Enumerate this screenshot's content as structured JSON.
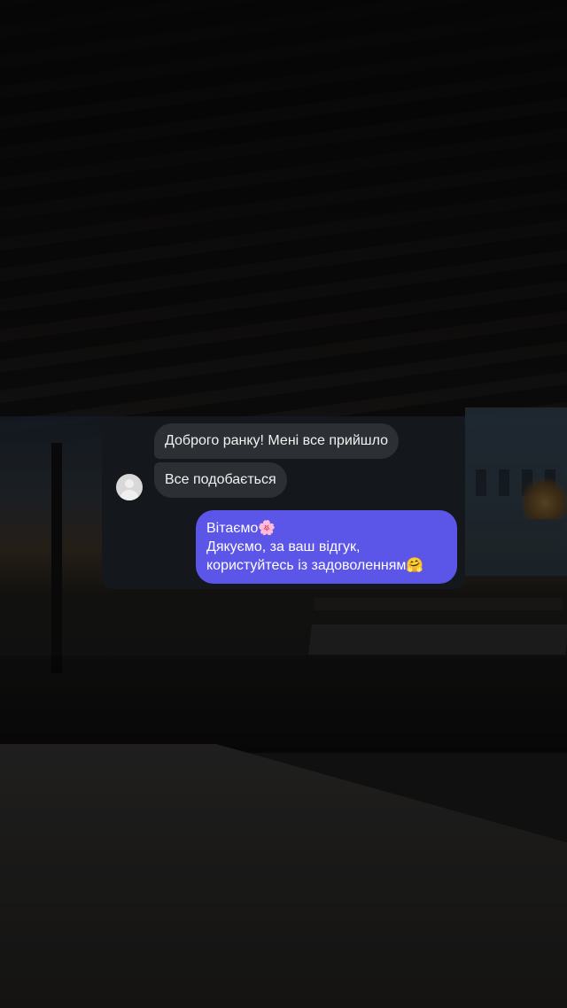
{
  "background": {
    "description_colors": {
      "card": "#14171c",
      "incoming_bubble": "#2c2f33",
      "outgoing_bubble": "#5b55e8"
    }
  },
  "chat": {
    "incoming": [
      {
        "text": "Доброго ранку! Мені все прийшло"
      },
      {
        "text": "Все подобається"
      }
    ],
    "outgoing": {
      "lines": [
        "Вітаємо🌸",
        "Дякуємо, за ваш відгук,",
        "користуйтесь із задоволенням🤗"
      ]
    }
  }
}
